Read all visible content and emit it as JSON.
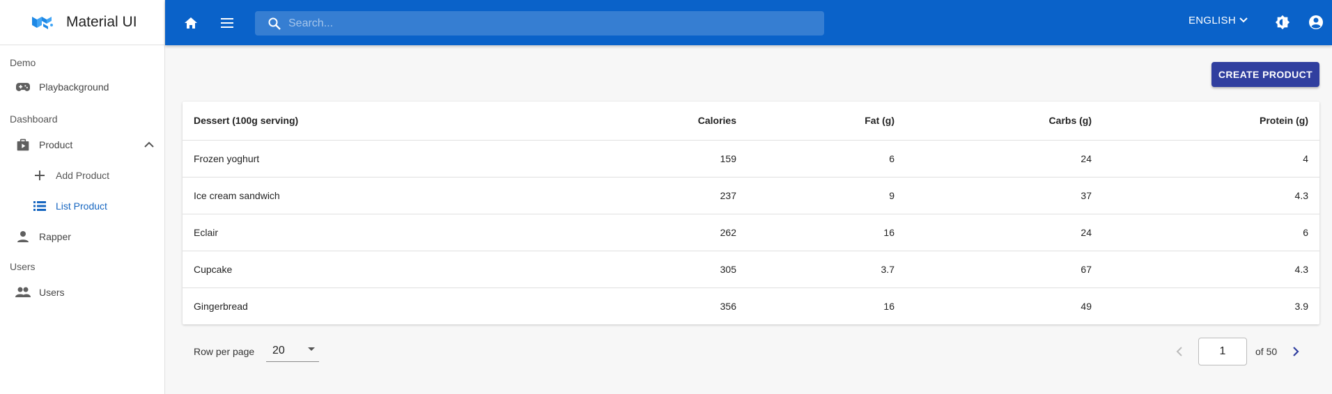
{
  "brand": {
    "title": "Material UI"
  },
  "sidebar": {
    "sections": [
      {
        "label": "Demo"
      },
      {
        "label": "Dashboard"
      },
      {
        "label": "Users"
      }
    ],
    "items": {
      "playbackground": "Playbackground",
      "product": "Product",
      "add_product": "Add Product",
      "list_product": "List Product",
      "rapper": "Rapper",
      "users": "Users"
    }
  },
  "topbar": {
    "search_placeholder": "Search...",
    "language": "ENGLISH"
  },
  "main": {
    "create_button": "CREATE PRODUCT",
    "table": {
      "headers": [
        "Dessert (100g serving)",
        "Calories",
        "Fat (g)",
        "Carbs (g)",
        "Protein (g)"
      ],
      "rows": [
        [
          "Frozen yoghurt",
          "159",
          "6",
          "24",
          "4"
        ],
        [
          "Ice cream sandwich",
          "237",
          "9",
          "37",
          "4.3"
        ],
        [
          "Eclair",
          "262",
          "16",
          "24",
          "6"
        ],
        [
          "Cupcake",
          "305",
          "3.7",
          "67",
          "4.3"
        ],
        [
          "Gingerbread",
          "356",
          "16",
          "49",
          "3.9"
        ]
      ]
    },
    "pagination": {
      "rows_per_page_label": "Row per page",
      "rows_per_page_value": "20",
      "current_page": "1",
      "of_label": "of 50"
    }
  },
  "colors": {
    "appbar": "#0a62c9",
    "accent": "#303f9f",
    "active_nav": "#1565c0"
  }
}
